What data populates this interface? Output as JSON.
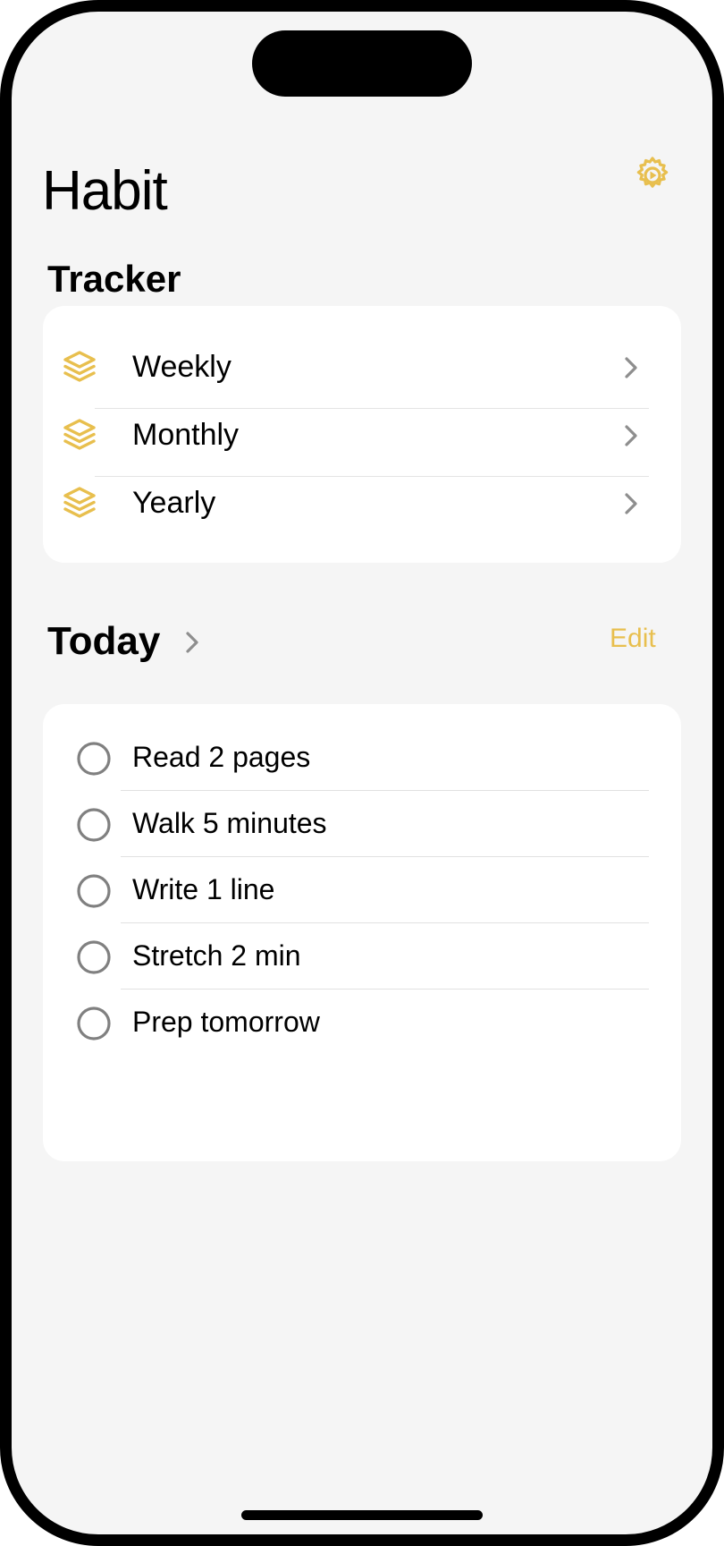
{
  "colors": {
    "accent": "#E8BF4E",
    "background": "#F5F5F5",
    "card": "#FFFFFF",
    "checkbox": "#808080",
    "chevron": "#8E8E8E"
  },
  "header": {
    "title": "Habit",
    "settings_icon": "gear-icon"
  },
  "tracker": {
    "heading": "Tracker",
    "items": [
      {
        "label": "Weekly",
        "icon": "layers-icon"
      },
      {
        "label": "Monthly",
        "icon": "layers-icon"
      },
      {
        "label": "Yearly",
        "icon": "layers-icon"
      }
    ]
  },
  "today": {
    "heading": "Today",
    "edit_label": "Edit",
    "tasks": [
      {
        "label": "Read 2 pages",
        "done": false
      },
      {
        "label": "Walk 5 minutes",
        "done": false
      },
      {
        "label": "Write 1 line",
        "done": false
      },
      {
        "label": "Stretch 2 min",
        "done": false
      },
      {
        "label": "Prep tomorrow",
        "done": false
      }
    ]
  }
}
